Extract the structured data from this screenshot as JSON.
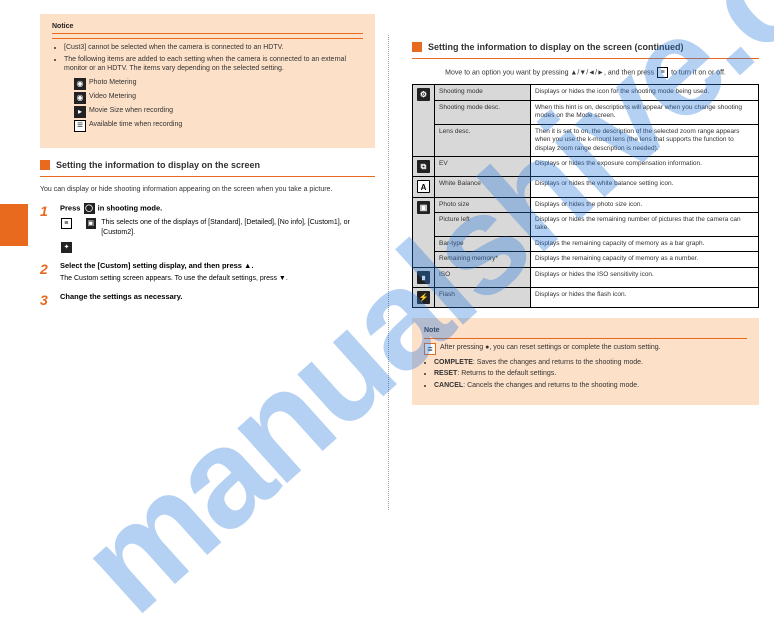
{
  "watermark": "manualshive.com",
  "left": {
    "notice_box": {
      "title": "Notice",
      "bullets": [
        "[Cust3] cannot be selected when the camera is connected to an HDTV.",
        "The following items are added to each setting when the camera is connected to an external monitor or an HDTV. The items vary depending on the selected setting."
      ],
      "icon_lines": [
        {
          "icon": "metering-icon",
          "text": "Photo Metering"
        },
        {
          "icon": "metering-video-icon",
          "text": "Video Metering"
        },
        {
          "icon": "movie-icon",
          "text": "Movie Size when recording"
        },
        {
          "icon": "menu-icon",
          "text": "Available time when recording"
        }
      ]
    },
    "section_title": "Setting the information to display on the screen",
    "intro_text": "You can display or hide shooting information appearing on the screen when you take a picture.",
    "step1": {
      "num": "1",
      "head": "Press ● in shooting mode.",
      "body": "This selects one of the displays of [Standard], [Detailed], [No info], [Custom1], or [Custom2]."
    },
    "step2": {
      "num": "2",
      "head": "Select the [Custom] setting display, and then press ▲.",
      "body": "The Custom setting screen appears. To use the default settings, press ▼."
    },
    "step3": {
      "num": "3",
      "head": "Change the settings as necessary.",
      "body": ""
    }
  },
  "right": {
    "section_title": "Setting the information to display on the screen (continued)",
    "lead_text": "Move to an option you want by pressing ▲/▼/◄/►, and then press ● to turn it on or off.",
    "table": {
      "rows": [
        {
          "icon": "gear-icon",
          "glyph": "⚙",
          "rowspan": 3,
          "label": "Shooting mode",
          "desc": "Displays or hides the icon for the shooting mode being used."
        },
        {
          "label": "Shooting mode desc.",
          "desc": "When this hint is on, descriptions will appear when you change shooting modes on the Mode screen."
        },
        {
          "label": "Lens desc.",
          "desc": "Then it is set to on, the description of the selected zoom range appears when you use the k-mount lens (the lens that supports the function to display zoom range description is needed)."
        },
        {
          "icon": "ev-icon",
          "glyph": "⧉",
          "label": "EV",
          "desc": "Displays or hides the exposure compensation information."
        },
        {
          "icon": "wb-icon",
          "glyph": "A",
          "label": "White Balance",
          "desc": "Displays or hides the white balance setting icon."
        },
        {
          "icon": "picture-icon",
          "glyph": "▣",
          "rowspan": 4,
          "label": "Photo size",
          "desc": "Displays or hides the photo size icon."
        },
        {
          "label": "Picture left",
          "desc": "Displays or hides the remaining number of pictures that the camera can take."
        },
        {
          "label": "Bar-type",
          "desc": "Displays the remaining capacity of memory as a bar graph."
        },
        {
          "label": "Remaining memory*",
          "desc": "Displays the remaining capacity of memory as a number."
        },
        {
          "icon": "iso-icon",
          "glyph": "∎",
          "label": "ISO",
          "desc": "Displays or hides the ISO sensitivity icon."
        },
        {
          "icon": "flash-icon",
          "glyph": "⚡",
          "label": "Flash",
          "desc": "Displays or hides the flash icon."
        }
      ]
    },
    "note": {
      "title": "Note",
      "line1": "After pressing ●, you can reset settings or complete the custom setting.",
      "items": [
        {
          "label": "COMPLETE",
          "desc": "Saves the changes and returns to the shooting mode."
        },
        {
          "label": "RESET",
          "desc": "Returns to the default settings."
        },
        {
          "label": "CANCEL",
          "desc": "Cancels the changes and returns to the shooting mode."
        }
      ]
    }
  }
}
